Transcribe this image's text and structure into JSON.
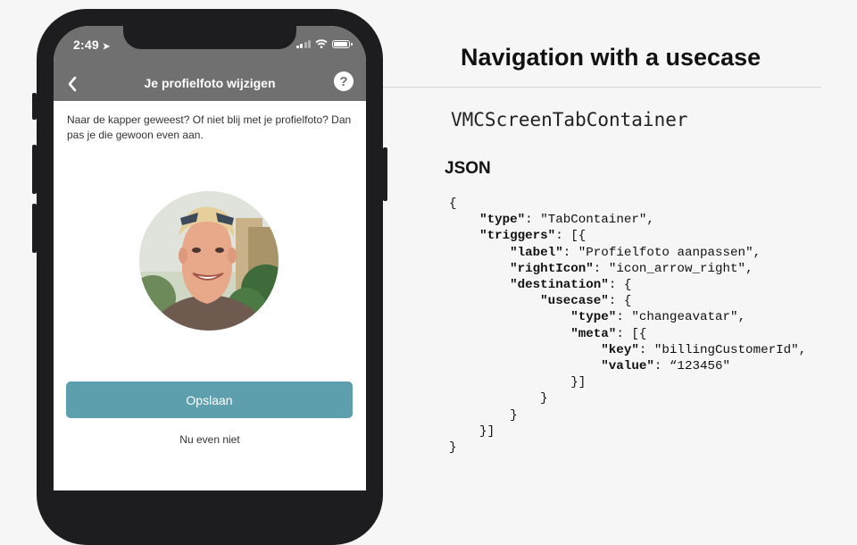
{
  "phone": {
    "status_bar": {
      "time": "2:49",
      "location_icon": "location-arrow-icon"
    },
    "nav": {
      "back_icon": "chevron-left-icon",
      "title": "Je profielfoto wijzigen",
      "help_label": "?"
    },
    "intro_text": "Naar de kapper geweest? Of niet blij met je profielfoto? Dan pas je die gewoon even aan.",
    "save_label": "Opslaan",
    "skip_label": "Nu even niet",
    "colors": {
      "nav_bg": "#707070",
      "button": "#5e9fae"
    }
  },
  "slide": {
    "title": "Navigation with a usecase",
    "component_name": "VMCScreenTabContainer",
    "json_heading": "JSON",
    "code": {
      "type_value": "\"TabContainer\"",
      "label_value": "\"Profielfoto aanpassen\"",
      "right_icon_value": "\"icon_arrow_right\"",
      "usecase_type_value": "\"changeavatar\"",
      "meta_key_value": "\"billingCustomerId\"",
      "meta_value_value": "“123456\""
    }
  }
}
